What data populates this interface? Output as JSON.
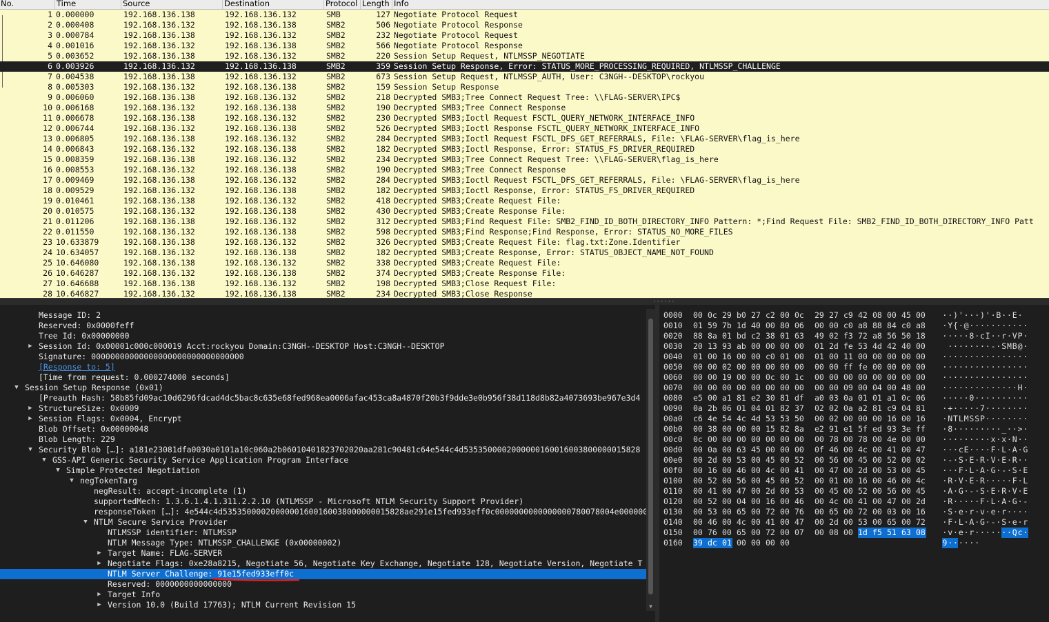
{
  "packet_list": {
    "columns": [
      "No.",
      "Time",
      "Source",
      "Destination",
      "Protocol",
      "Length",
      "Info"
    ],
    "rows": [
      {
        "no": "1",
        "time": "0.000000",
        "src": "192.168.136.138",
        "dst": "192.168.136.132",
        "proto": "SMB",
        "len": "127",
        "info": "Negotiate Protocol Request"
      },
      {
        "no": "2",
        "time": "0.000408",
        "src": "192.168.136.132",
        "dst": "192.168.136.138",
        "proto": "SMB2",
        "len": "506",
        "info": "Negotiate Protocol Response"
      },
      {
        "no": "3",
        "time": "0.000784",
        "src": "192.168.136.138",
        "dst": "192.168.136.132",
        "proto": "SMB2",
        "len": "232",
        "info": "Negotiate Protocol Request"
      },
      {
        "no": "4",
        "time": "0.001016",
        "src": "192.168.136.132",
        "dst": "192.168.136.138",
        "proto": "SMB2",
        "len": "566",
        "info": "Negotiate Protocol Response"
      },
      {
        "no": "5",
        "time": "0.003652",
        "src": "192.168.136.138",
        "dst": "192.168.136.132",
        "proto": "SMB2",
        "len": "220",
        "info": "Session Setup Request, NTLMSSP_NEGOTIATE"
      },
      {
        "no": "6",
        "time": "0.003926",
        "src": "192.168.136.132",
        "dst": "192.168.136.138",
        "proto": "SMB2",
        "len": "359",
        "info": "Session Setup Response, Error: STATUS_MORE_PROCESSING_REQUIRED, NTLMSSP_CHALLENGE"
      },
      {
        "no": "7",
        "time": "0.004538",
        "src": "192.168.136.138",
        "dst": "192.168.136.132",
        "proto": "SMB2",
        "len": "673",
        "info": "Session Setup Request, NTLMSSP_AUTH, User: C3NGH--DESKTOP\\rockyou"
      },
      {
        "no": "8",
        "time": "0.005303",
        "src": "192.168.136.132",
        "dst": "192.168.136.138",
        "proto": "SMB2",
        "len": "159",
        "info": "Session Setup Response"
      },
      {
        "no": "9",
        "time": "0.006060",
        "src": "192.168.136.138",
        "dst": "192.168.136.132",
        "proto": "SMB2",
        "len": "218",
        "info": "Decrypted SMB3;Tree Connect Request Tree: \\\\FLAG-SERVER\\IPC$"
      },
      {
        "no": "10",
        "time": "0.006168",
        "src": "192.168.136.132",
        "dst": "192.168.136.138",
        "proto": "SMB2",
        "len": "190",
        "info": "Decrypted SMB3;Tree Connect Response"
      },
      {
        "no": "11",
        "time": "0.006678",
        "src": "192.168.136.138",
        "dst": "192.168.136.132",
        "proto": "SMB2",
        "len": "230",
        "info": "Decrypted SMB3;Ioctl Request FSCTL_QUERY_NETWORK_INTERFACE_INFO"
      },
      {
        "no": "12",
        "time": "0.006744",
        "src": "192.168.136.132",
        "dst": "192.168.136.138",
        "proto": "SMB2",
        "len": "526",
        "info": "Decrypted SMB3;Ioctl Response FSCTL_QUERY_NETWORK_INTERFACE_INFO"
      },
      {
        "no": "13",
        "time": "0.006805",
        "src": "192.168.136.138",
        "dst": "192.168.136.132",
        "proto": "SMB2",
        "len": "284",
        "info": "Decrypted SMB3;Ioctl Request FSCTL_DFS_GET_REFERRALS, File: \\FLAG-SERVER\\flag_is_here"
      },
      {
        "no": "14",
        "time": "0.006843",
        "src": "192.168.136.132",
        "dst": "192.168.136.138",
        "proto": "SMB2",
        "len": "182",
        "info": "Decrypted SMB3;Ioctl Response, Error: STATUS_FS_DRIVER_REQUIRED"
      },
      {
        "no": "15",
        "time": "0.008359",
        "src": "192.168.136.138",
        "dst": "192.168.136.132",
        "proto": "SMB2",
        "len": "234",
        "info": "Decrypted SMB3;Tree Connect Request Tree: \\\\FLAG-SERVER\\flag_is_here"
      },
      {
        "no": "16",
        "time": "0.008553",
        "src": "192.168.136.132",
        "dst": "192.168.136.138",
        "proto": "SMB2",
        "len": "190",
        "info": "Decrypted SMB3;Tree Connect Response"
      },
      {
        "no": "17",
        "time": "0.009469",
        "src": "192.168.136.138",
        "dst": "192.168.136.132",
        "proto": "SMB2",
        "len": "284",
        "info": "Decrypted SMB3;Ioctl Request FSCTL_DFS_GET_REFERRALS, File: \\FLAG-SERVER\\flag_is_here"
      },
      {
        "no": "18",
        "time": "0.009529",
        "src": "192.168.136.132",
        "dst": "192.168.136.138",
        "proto": "SMB2",
        "len": "182",
        "info": "Decrypted SMB3;Ioctl Response, Error: STATUS_FS_DRIVER_REQUIRED"
      },
      {
        "no": "19",
        "time": "0.010461",
        "src": "192.168.136.138",
        "dst": "192.168.136.132",
        "proto": "SMB2",
        "len": "418",
        "info": "Decrypted SMB3;Create Request File:"
      },
      {
        "no": "20",
        "time": "0.010575",
        "src": "192.168.136.132",
        "dst": "192.168.136.138",
        "proto": "SMB2",
        "len": "430",
        "info": "Decrypted SMB3;Create Response File:"
      },
      {
        "no": "21",
        "time": "0.011206",
        "src": "192.168.136.138",
        "dst": "192.168.136.132",
        "proto": "SMB2",
        "len": "312",
        "info": "Decrypted SMB3;Find Request File:  SMB2_FIND_ID_BOTH_DIRECTORY_INFO Pattern: *;Find Request File:  SMB2_FIND_ID_BOTH_DIRECTORY_INFO Patt"
      },
      {
        "no": "22",
        "time": "0.011550",
        "src": "192.168.136.132",
        "dst": "192.168.136.138",
        "proto": "SMB2",
        "len": "598",
        "info": "Decrypted SMB3;Find Response;Find Response, Error: STATUS_NO_MORE_FILES"
      },
      {
        "no": "23",
        "time": "10.633879",
        "src": "192.168.136.138",
        "dst": "192.168.136.132",
        "proto": "SMB2",
        "len": "326",
        "info": "Decrypted SMB3;Create Request File: flag.txt:Zone.Identifier"
      },
      {
        "no": "24",
        "time": "10.634057",
        "src": "192.168.136.132",
        "dst": "192.168.136.138",
        "proto": "SMB2",
        "len": "182",
        "info": "Decrypted SMB3;Create Response, Error: STATUS_OBJECT_NAME_NOT_FOUND"
      },
      {
        "no": "25",
        "time": "10.646080",
        "src": "192.168.136.138",
        "dst": "192.168.136.132",
        "proto": "SMB2",
        "len": "338",
        "info": "Decrypted SMB3;Create Request File:"
      },
      {
        "no": "26",
        "time": "10.646287",
        "src": "192.168.136.132",
        "dst": "192.168.136.138",
        "proto": "SMB2",
        "len": "374",
        "info": "Decrypted SMB3;Create Response File:"
      },
      {
        "no": "27",
        "time": "10.646688",
        "src": "192.168.136.138",
        "dst": "192.168.136.132",
        "proto": "SMB2",
        "len": "198",
        "info": "Decrypted SMB3;Close Request File:"
      },
      {
        "no": "28",
        "time": "10.646827",
        "src": "192.168.136.132",
        "dst": "192.168.136.138",
        "proto": "SMB2",
        "len": "234",
        "info": "Decrypted SMB3;Close Response"
      }
    ],
    "selected_index": 5
  },
  "details": {
    "rows": [
      {
        "indent": 56,
        "text": "Message ID: 2"
      },
      {
        "indent": 56,
        "text": "Reserved: 0x0000feff"
      },
      {
        "indent": 56,
        "text": "Tree Id: 0x00000000"
      },
      {
        "indent": 56,
        "tw": "▶",
        "text": "Session Id: 0x00001c000c000019 Acct:rockyou Domain:C3NGH--DESKTOP Host:C3NGH--DESKTOP"
      },
      {
        "indent": 56,
        "text": "Signature: 00000000000000000000000000000000"
      },
      {
        "indent": 56,
        "text": "[Response to: 5]",
        "link": true
      },
      {
        "indent": 56,
        "text": "[Time from request: 0.000274000 seconds]"
      },
      {
        "indent": 36,
        "tw": "▼",
        "text": "Session Setup Response (0x01)"
      },
      {
        "indent": 56,
        "text": "[Preauth Hash: 58b85fd09ac10d6296fdcad4dc5bac8c635e68fed968ea0006afac453ca8a4870f20b3f9dde3e0b956f38d118d8b82a4073693be967e3d4"
      },
      {
        "indent": 56,
        "tw": "▶",
        "text": "StructureSize: 0x0009"
      },
      {
        "indent": 56,
        "tw": "▶",
        "text": "Session Flags: 0x0004, Encrypt"
      },
      {
        "indent": 56,
        "text": "Blob Offset: 0x00000048"
      },
      {
        "indent": 56,
        "text": "Blob Length: 229"
      },
      {
        "indent": 56,
        "tw": "▼",
        "text": "Security Blob […]: a181e23081dfa0030a0101a10c060a2b06010401823702020aa281c90481c64e544c4d5353500002000000160016003800000015828"
      },
      {
        "indent": 76,
        "tw": "▼",
        "text": "GSS-API Generic Security Service Application Program Interface"
      },
      {
        "indent": 96,
        "tw": "▼",
        "text": "Simple Protected Negotiation"
      },
      {
        "indent": 116,
        "tw": "▼",
        "text": "negTokenTarg"
      },
      {
        "indent": 136,
        "text": "negResult: accept-incomplete (1)"
      },
      {
        "indent": 136,
        "text": "supportedMech: 1.3.6.1.4.1.311.2.2.10 (NTLMSSP - Microsoft NTLM Security Support Provider)"
      },
      {
        "indent": 136,
        "text": "responseToken […]: 4e544c4d53535000020000001600160038000000015828ae291e15fed933eff0c0000000000000000780078004e000000"
      },
      {
        "indent": 136,
        "tw": "▼",
        "text": "NTLM Secure Service Provider"
      },
      {
        "indent": 156,
        "text": "NTLMSSP identifier: NTLMSSP"
      },
      {
        "indent": 156,
        "text": "NTLM Message Type: NTLMSSP_CHALLENGE (0x00000002)"
      },
      {
        "indent": 156,
        "tw": "▶",
        "text": "Target Name: FLAG-SERVER"
      },
      {
        "indent": 156,
        "tw": "▶",
        "text": "Negotiate Flags: 0xe28a8215, Negotiate 56, Negotiate Key Exchange, Negotiate 128, Negotiate Version, Negotiate T"
      },
      {
        "indent": 156,
        "text": "NTLM Server Challenge: 91e15fed933eff0c",
        "selected": true
      },
      {
        "indent": 156,
        "text": "Reserved: 0000000000000000"
      },
      {
        "indent": 156,
        "tw": "▶",
        "text": "Target Info"
      },
      {
        "indent": 156,
        "tw": "▶",
        "text": "Version 10.0 (Build 17763); NTLM Current Revision 15"
      }
    ]
  },
  "hex": {
    "rows": [
      {
        "off": "0000",
        "bytes": [
          "00",
          "0c",
          "29",
          "b0",
          "27",
          "c2",
          "00",
          "0c",
          "29",
          "27",
          "c9",
          "42",
          "08",
          "00",
          "45",
          "00"
        ],
        "ascii": "··)'···)'·B··E·"
      },
      {
        "off": "0010",
        "bytes": [
          "01",
          "59",
          "7b",
          "1d",
          "40",
          "00",
          "80",
          "06",
          "00",
          "00",
          "c0",
          "a8",
          "88",
          "84",
          "c0",
          "a8"
        ],
        "ascii": "·Y{·@···········"
      },
      {
        "off": "0020",
        "bytes": [
          "88",
          "8a",
          "01",
          "bd",
          "c2",
          "38",
          "01",
          "63",
          "49",
          "02",
          "f3",
          "72",
          "a8",
          "56",
          "50",
          "18"
        ],
        "ascii": "·····8·cI··r·VP·"
      },
      {
        "off": "0030",
        "bytes": [
          "20",
          "13",
          "93",
          "ab",
          "00",
          "00",
          "00",
          "00",
          "01",
          "2d",
          "fe",
          "53",
          "4d",
          "42",
          "40",
          "00"
        ],
        "ascii": " ········-·SMB@·"
      },
      {
        "off": "0040",
        "bytes": [
          "01",
          "00",
          "16",
          "00",
          "00",
          "c0",
          "01",
          "00",
          "01",
          "00",
          "11",
          "00",
          "00",
          "00",
          "00",
          "00"
        ],
        "ascii": "················"
      },
      {
        "off": "0050",
        "bytes": [
          "00",
          "00",
          "02",
          "00",
          "00",
          "00",
          "00",
          "00",
          "00",
          "00",
          "ff",
          "fe",
          "00",
          "00",
          "00",
          "00"
        ],
        "ascii": "················"
      },
      {
        "off": "0060",
        "bytes": [
          "00",
          "00",
          "19",
          "00",
          "00",
          "0c",
          "00",
          "1c",
          "00",
          "00",
          "00",
          "00",
          "00",
          "00",
          "00",
          "00"
        ],
        "ascii": "················"
      },
      {
        "off": "0070",
        "bytes": [
          "00",
          "00",
          "00",
          "00",
          "00",
          "00",
          "00",
          "00",
          "00",
          "00",
          "09",
          "00",
          "04",
          "00",
          "48",
          "00"
        ],
        "ascii": "··············H·"
      },
      {
        "off": "0080",
        "bytes": [
          "e5",
          "00",
          "a1",
          "81",
          "e2",
          "30",
          "81",
          "df",
          "a0",
          "03",
          "0a",
          "01",
          "01",
          "a1",
          "0c",
          "06"
        ],
        "ascii": "·····0··········"
      },
      {
        "off": "0090",
        "bytes": [
          "0a",
          "2b",
          "06",
          "01",
          "04",
          "01",
          "82",
          "37",
          "02",
          "02",
          "0a",
          "a2",
          "81",
          "c9",
          "04",
          "81"
        ],
        "ascii": "·+·····7········"
      },
      {
        "off": "00a0",
        "bytes": [
          "c6",
          "4e",
          "54",
          "4c",
          "4d",
          "53",
          "53",
          "50",
          "00",
          "02",
          "00",
          "00",
          "00",
          "16",
          "00",
          "16"
        ],
        "ascii": "·NTLMSSP········"
      },
      {
        "off": "00b0",
        "bytes": [
          "00",
          "38",
          "00",
          "00",
          "00",
          "15",
          "82",
          "8a",
          "e2",
          "91",
          "e1",
          "5f",
          "ed",
          "93",
          "3e",
          "ff"
        ],
        "ascii": "·8·········_··>·"
      },
      {
        "off": "00c0",
        "bytes": [
          "0c",
          "00",
          "00",
          "00",
          "00",
          "00",
          "00",
          "00",
          "00",
          "78",
          "00",
          "78",
          "00",
          "4e",
          "00",
          "00"
        ],
        "ascii": "·········x·x·N··"
      },
      {
        "off": "00d0",
        "bytes": [
          "00",
          "0a",
          "00",
          "63",
          "45",
          "00",
          "00",
          "00",
          "0f",
          "46",
          "00",
          "4c",
          "00",
          "41",
          "00",
          "47"
        ],
        "ascii": "···cE····F·L·A·G"
      },
      {
        "off": "00e0",
        "bytes": [
          "00",
          "2d",
          "00",
          "53",
          "00",
          "45",
          "00",
          "52",
          "00",
          "56",
          "00",
          "45",
          "00",
          "52",
          "00",
          "02"
        ],
        "ascii": "·-·S·E·R·V·E·R··"
      },
      {
        "off": "00f0",
        "bytes": [
          "00",
          "16",
          "00",
          "46",
          "00",
          "4c",
          "00",
          "41",
          "00",
          "47",
          "00",
          "2d",
          "00",
          "53",
          "00",
          "45"
        ],
        "ascii": "···F·L·A·G·-·S·E"
      },
      {
        "off": "0100",
        "bytes": [
          "00",
          "52",
          "00",
          "56",
          "00",
          "45",
          "00",
          "52",
          "00",
          "01",
          "00",
          "16",
          "00",
          "46",
          "00",
          "4c"
        ],
        "ascii": "·R·V·E·R·····F·L"
      },
      {
        "off": "0110",
        "bytes": [
          "00",
          "41",
          "00",
          "47",
          "00",
          "2d",
          "00",
          "53",
          "00",
          "45",
          "00",
          "52",
          "00",
          "56",
          "00",
          "45"
        ],
        "ascii": "·A·G·-·S·E·R·V·E"
      },
      {
        "off": "0120",
        "bytes": [
          "00",
          "52",
          "00",
          "04",
          "00",
          "16",
          "00",
          "46",
          "00",
          "4c",
          "00",
          "41",
          "00",
          "47",
          "00",
          "2d"
        ],
        "ascii": "·R·····F·L·A·G·-"
      },
      {
        "off": "0130",
        "bytes": [
          "00",
          "53",
          "00",
          "65",
          "00",
          "72",
          "00",
          "76",
          "00",
          "65",
          "00",
          "72",
          "00",
          "03",
          "00",
          "16"
        ],
        "ascii": "·S·e·r·v·e·r····"
      },
      {
        "off": "0140",
        "bytes": [
          "00",
          "46",
          "00",
          "4c",
          "00",
          "41",
          "00",
          "47",
          "00",
          "2d",
          "00",
          "53",
          "00",
          "65",
          "00",
          "72"
        ],
        "ascii": "·F·L·A·G·-·S·e·r"
      },
      {
        "off": "0150",
        "bytes": [
          "00",
          "76",
          "00",
          "65",
          "00",
          "72",
          "00",
          "07",
          "00",
          "08",
          "00",
          "1d",
          "f5",
          "51",
          "63",
          "08"
        ],
        "ascii": "·v·e·r·······Qc·",
        "hl_from": 11
      },
      {
        "off": "0160",
        "bytes": [
          "39",
          "dc",
          "01",
          "00",
          "00",
          "00",
          "00"
        ],
        "ascii": "9······",
        "hl_to": 3
      }
    ]
  }
}
